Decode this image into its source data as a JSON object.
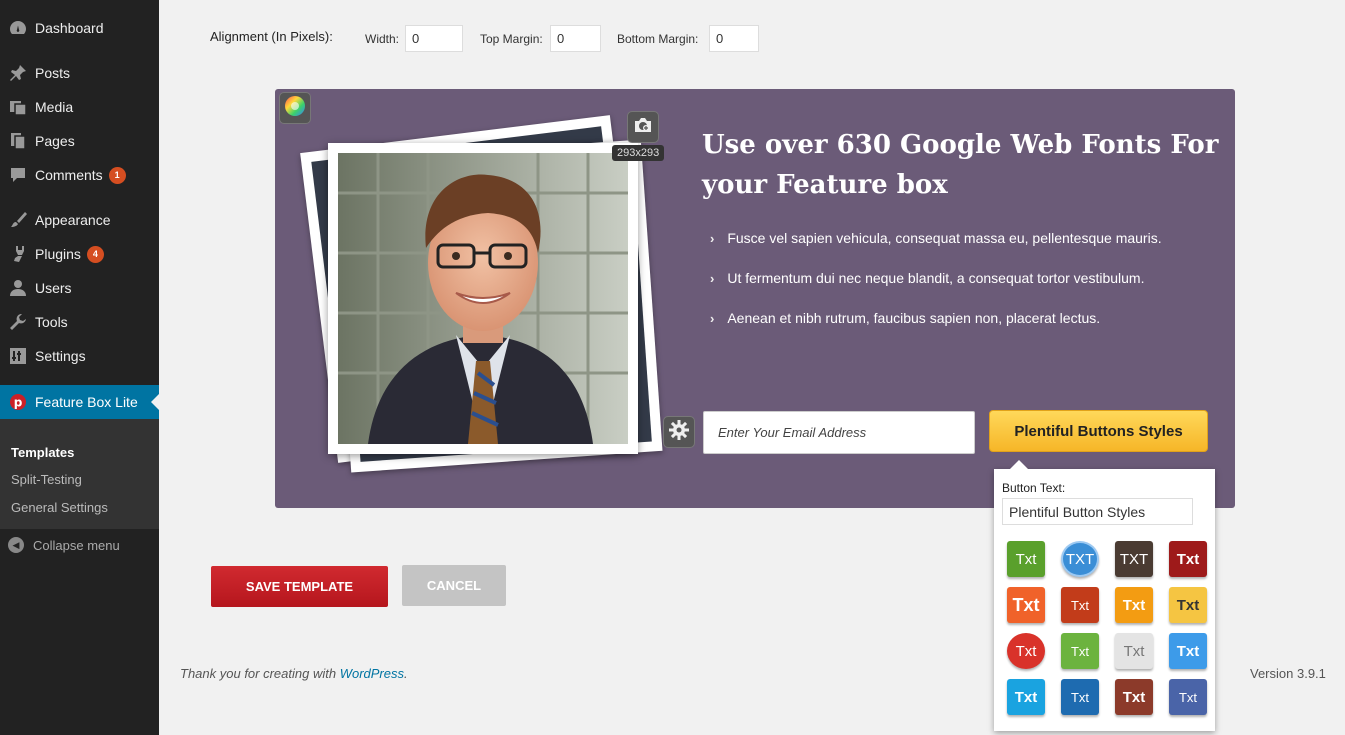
{
  "sidebar": {
    "items": [
      {
        "label": "Dashboard",
        "icon": "dashboard-icon",
        "badge": ""
      },
      {
        "label": "Posts",
        "icon": "pin-icon",
        "badge": ""
      },
      {
        "label": "Media",
        "icon": "media-icon",
        "badge": ""
      },
      {
        "label": "Pages",
        "icon": "pages-icon",
        "badge": ""
      },
      {
        "label": "Comments",
        "icon": "comment-icon",
        "badge": "1"
      },
      {
        "label": "Appearance",
        "icon": "brush-icon",
        "badge": ""
      },
      {
        "label": "Plugins",
        "icon": "plug-icon",
        "badge": "4"
      },
      {
        "label": "Users",
        "icon": "user-icon",
        "badge": ""
      },
      {
        "label": "Tools",
        "icon": "wrench-icon",
        "badge": ""
      },
      {
        "label": "Settings",
        "icon": "settings-icon",
        "badge": ""
      },
      {
        "label": "Feature Box Lite",
        "icon": "pinterest-icon",
        "badge": ""
      }
    ],
    "submenu": [
      "Templates",
      "Split-Testing",
      "General Settings"
    ],
    "collapse_label": "Collapse menu"
  },
  "form": {
    "alignment_label": "Alignment (In Pixels):",
    "width_label": "Width:",
    "width_value": "0",
    "top_margin_label": "Top Margin:",
    "top_margin_value": "0",
    "bottom_margin_label": "Bottom Margin:",
    "bottom_margin_value": "0"
  },
  "feature_box": {
    "background_color": "#6b5b78",
    "image_size": "293x293",
    "headline": "Use over 630 Google Web Fonts For your Feature box",
    "bullets": [
      "Fusce vel sapien vehicula, consequat massa eu, pellentesque mauris.",
      "Ut fermentum dui nec neque blandit, a consequat tortor vestibulum.",
      "Aenean et nibh rutrum, faucibus sapien non, placerat lectus."
    ],
    "email_placeholder": "Enter Your Email Address",
    "button_label": "Plentiful Buttons Styles"
  },
  "popup": {
    "label": "Button Text:",
    "value": "Plentiful Button Styles",
    "swatches": [
      {
        "text": "Txt",
        "color": "#5aa02c"
      },
      {
        "text": "TXT",
        "color": "#3a8ed6"
      },
      {
        "text": "TXT",
        "color": "#4a3b32"
      },
      {
        "text": "Txt",
        "color": "#9e1a1a"
      },
      {
        "text": "Txt",
        "color": "#f0622a"
      },
      {
        "text": "Txt",
        "color": "#c23c1a"
      },
      {
        "text": "Txt",
        "color": "#f39c12"
      },
      {
        "text": "Txt",
        "color": "#f5c542"
      },
      {
        "text": "Txt",
        "color": "#d9322a"
      },
      {
        "text": "Txt",
        "color": "#6cb33f"
      },
      {
        "text": "Txt",
        "color": "#e4e4e4"
      },
      {
        "text": "Txt",
        "color": "#3d9be9"
      },
      {
        "text": "Txt",
        "color": "#1aa3e0"
      },
      {
        "text": "Txt",
        "color": "#1e6bb0"
      },
      {
        "text": "Txt",
        "color": "#8c3a2a"
      },
      {
        "text": "Txt",
        "color": "#4a64a8"
      }
    ]
  },
  "actions": {
    "save_label": "SAVE TEMPLATE",
    "cancel_label": "CANCEL"
  },
  "footer": {
    "thanks_prefix": "Thank you for creating with ",
    "wordpress_link": "WordPress",
    "thanks_suffix": ".",
    "version": "Version 3.9.1"
  }
}
